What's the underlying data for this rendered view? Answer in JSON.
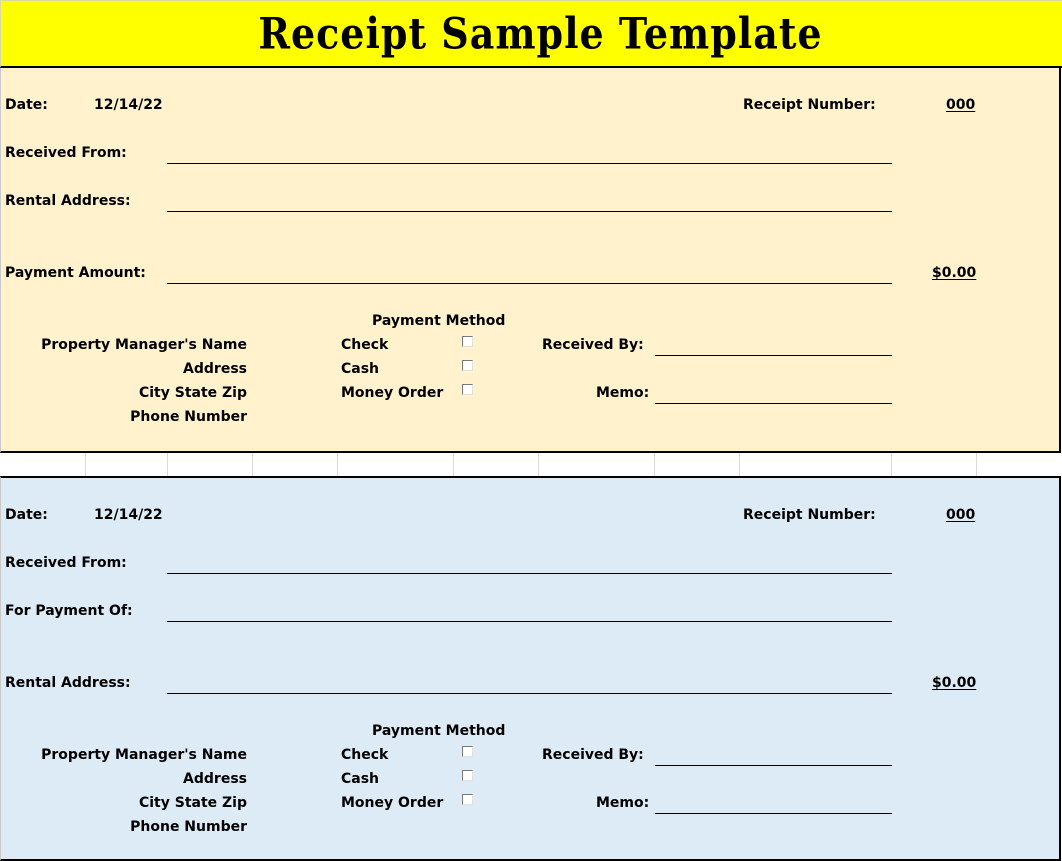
{
  "title": "Receipt Sample Template",
  "colors": {
    "title_bg": "#ffff00",
    "top_panel_bg": "#fff2cc",
    "bottom_panel_bg": "#ddebf7"
  },
  "receipts": [
    {
      "date_label": "Date:",
      "date_value": "12/14/22",
      "receipt_number_label": "Receipt Number:",
      "receipt_number_value": "000",
      "field1_label": "Received From:",
      "field2_label": "Rental Address:",
      "field3_label": "Payment Amount:",
      "amount_value": "$0.00",
      "manager_labels": [
        "Property Manager's Name",
        "Address",
        "City State Zip",
        "Phone Number"
      ],
      "payment_method_label": "Payment Method",
      "payment_methods": [
        {
          "label": "Check",
          "checked": false
        },
        {
          "label": "Cash",
          "checked": false
        },
        {
          "label": "Money Order",
          "checked": false
        }
      ],
      "received_by_label": "Received By:",
      "memo_label": "Memo:"
    },
    {
      "date_label": "Date:",
      "date_value": "12/14/22",
      "receipt_number_label": "Receipt Number:",
      "receipt_number_value": "000",
      "field1_label": "Received From:",
      "field2_label": "For Payment Of:",
      "field3_label": "Rental Address:",
      "amount_value": "$0.00",
      "manager_labels": [
        "Property Manager's Name",
        "Address",
        "City State Zip",
        "Phone Number"
      ],
      "payment_method_label": "Payment Method",
      "payment_methods": [
        {
          "label": "Check",
          "checked": false
        },
        {
          "label": "Cash",
          "checked": false
        },
        {
          "label": "Money Order",
          "checked": false
        }
      ],
      "received_by_label": "Received By:",
      "memo_label": "Memo:"
    }
  ]
}
